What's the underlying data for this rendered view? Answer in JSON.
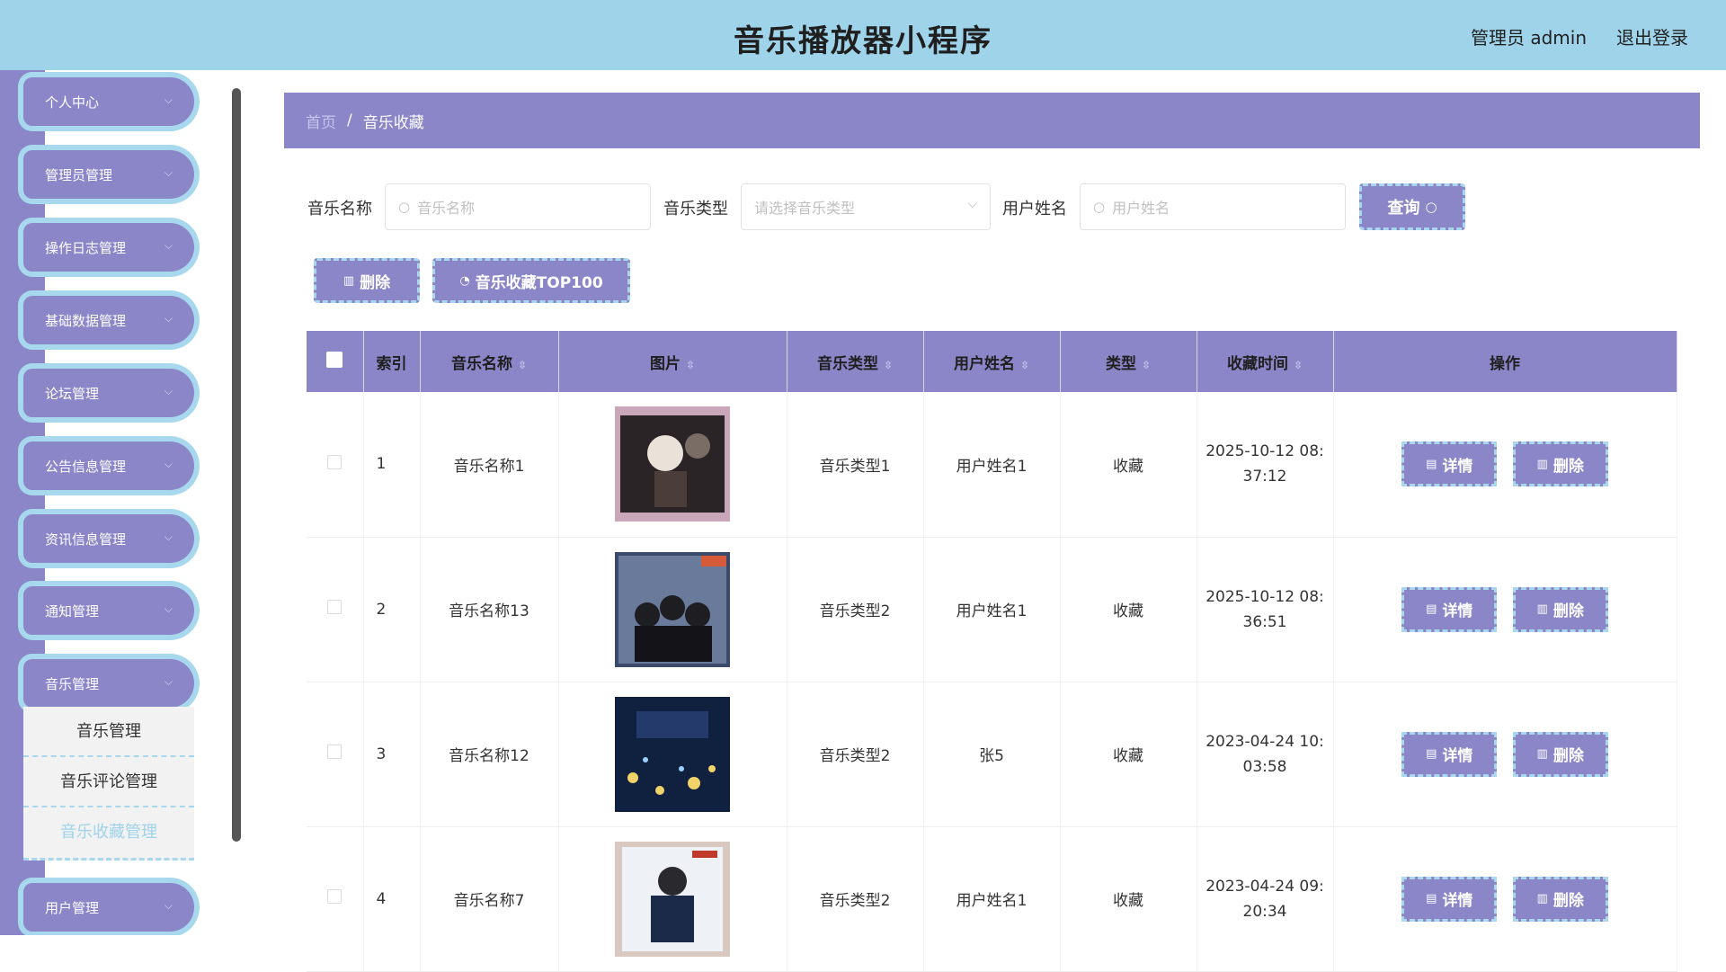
{
  "header": {
    "title": "音乐播放器小程序",
    "user": "管理员 admin",
    "logout": "退出登录"
  },
  "sidebar": {
    "items": [
      {
        "label": "个人中心"
      },
      {
        "label": "管理员管理"
      },
      {
        "label": "操作日志管理"
      },
      {
        "label": "基础数据管理"
      },
      {
        "label": "论坛管理"
      },
      {
        "label": "公告信息管理"
      },
      {
        "label": "资讯信息管理"
      },
      {
        "label": "通知管理"
      },
      {
        "label": "音乐管理"
      },
      {
        "label": "用户管理"
      }
    ],
    "submenu": [
      "音乐管理",
      "音乐评论管理",
      "音乐收藏管理"
    ]
  },
  "breadcrumb": {
    "home": "首页",
    "sep": "/",
    "current": "音乐收藏"
  },
  "search": {
    "name_label": "音乐名称",
    "name_placeholder": "音乐名称",
    "type_label": "音乐类型",
    "type_placeholder": "请选择音乐类型",
    "user_label": "用户姓名",
    "user_placeholder": "用户姓名",
    "query_label": "查询"
  },
  "actions": {
    "delete_label": "删除",
    "top100_label": "音乐收藏TOP100"
  },
  "table": {
    "headers": [
      "索引",
      "音乐名称",
      "图片",
      "音乐类型",
      "用户姓名",
      "类型",
      "收藏时间",
      "操作"
    ],
    "detail_label": "详情",
    "delete_label": "删除",
    "rows": [
      {
        "index": "1",
        "name": "音乐名称1",
        "type": "音乐类型1",
        "user": "用户姓名1",
        "kind": "收藏",
        "time1": "2025-10-12 08:",
        "time2": "37:12"
      },
      {
        "index": "2",
        "name": "音乐名称13",
        "type": "音乐类型2",
        "user": "用户姓名1",
        "kind": "收藏",
        "time1": "2025-10-12 08:",
        "time2": "36:51"
      },
      {
        "index": "3",
        "name": "音乐名称12",
        "type": "音乐类型2",
        "user": "张5",
        "kind": "收藏",
        "time1": "2023-04-24 10:",
        "time2": "03:58"
      },
      {
        "index": "4",
        "name": "音乐名称7",
        "type": "音乐类型2",
        "user": "用户姓名1",
        "kind": "收藏",
        "time1": "2023-04-24 09:",
        "time2": "20:34"
      }
    ]
  },
  "colors": {
    "accent": "#8a86c8",
    "highlight": "#a8d8ee",
    "topbar": "#9ed3ea"
  }
}
